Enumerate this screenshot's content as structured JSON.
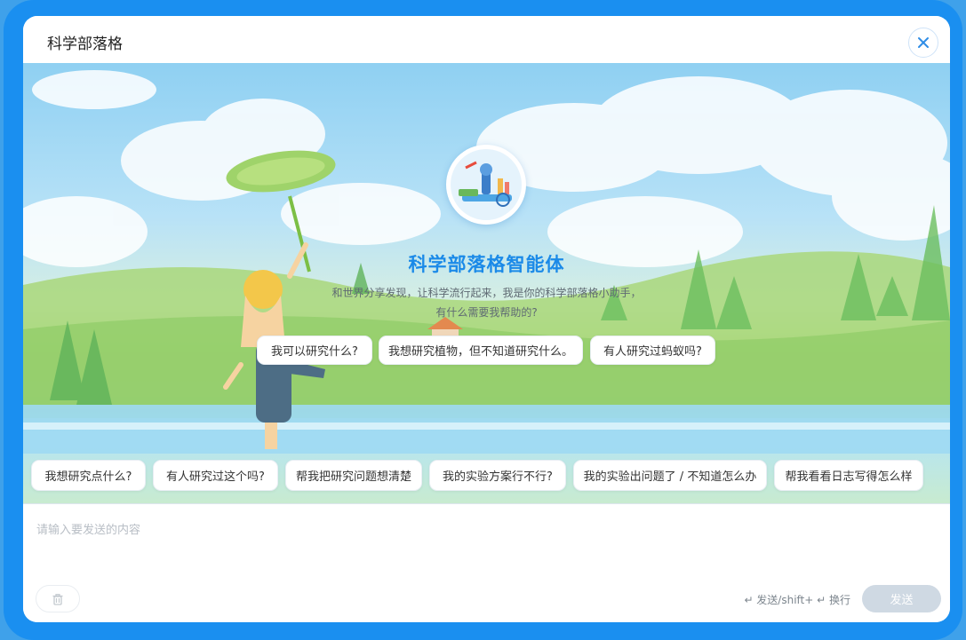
{
  "dialog": {
    "title": "科学部落格"
  },
  "agent": {
    "name": "科学部落格智能体",
    "intro_line1": "和世界分享发现，让科学流行起来，我是你的科学部落格小助手，",
    "intro_line2": "有什么需要我帮助的?"
  },
  "suggestions": [
    "我可以研究什么?",
    "我想研究植物，但不知道研究什么。",
    "有人研究过蚂蚁吗?"
  ],
  "quick_actions": [
    "我想研究点什么?",
    "有人研究过这个吗?",
    "帮我把研究问题想清楚",
    "我的实验方案行不行?",
    "我的实验出问题了 / 不知道怎么办",
    "帮我看看日志写得怎么样"
  ],
  "composer": {
    "placeholder": "请输入要发送的内容",
    "hint": "↵ 发送/shift+ ↵ 换行",
    "send_label": "发送"
  },
  "colors": {
    "frame": "#1a8ff0",
    "accent": "#1b8ae8",
    "send_disabled": "#cfd9e3"
  },
  "icons": {
    "close": "close-icon",
    "trash": "trash-icon",
    "avatar": "science-lab-avatar"
  }
}
